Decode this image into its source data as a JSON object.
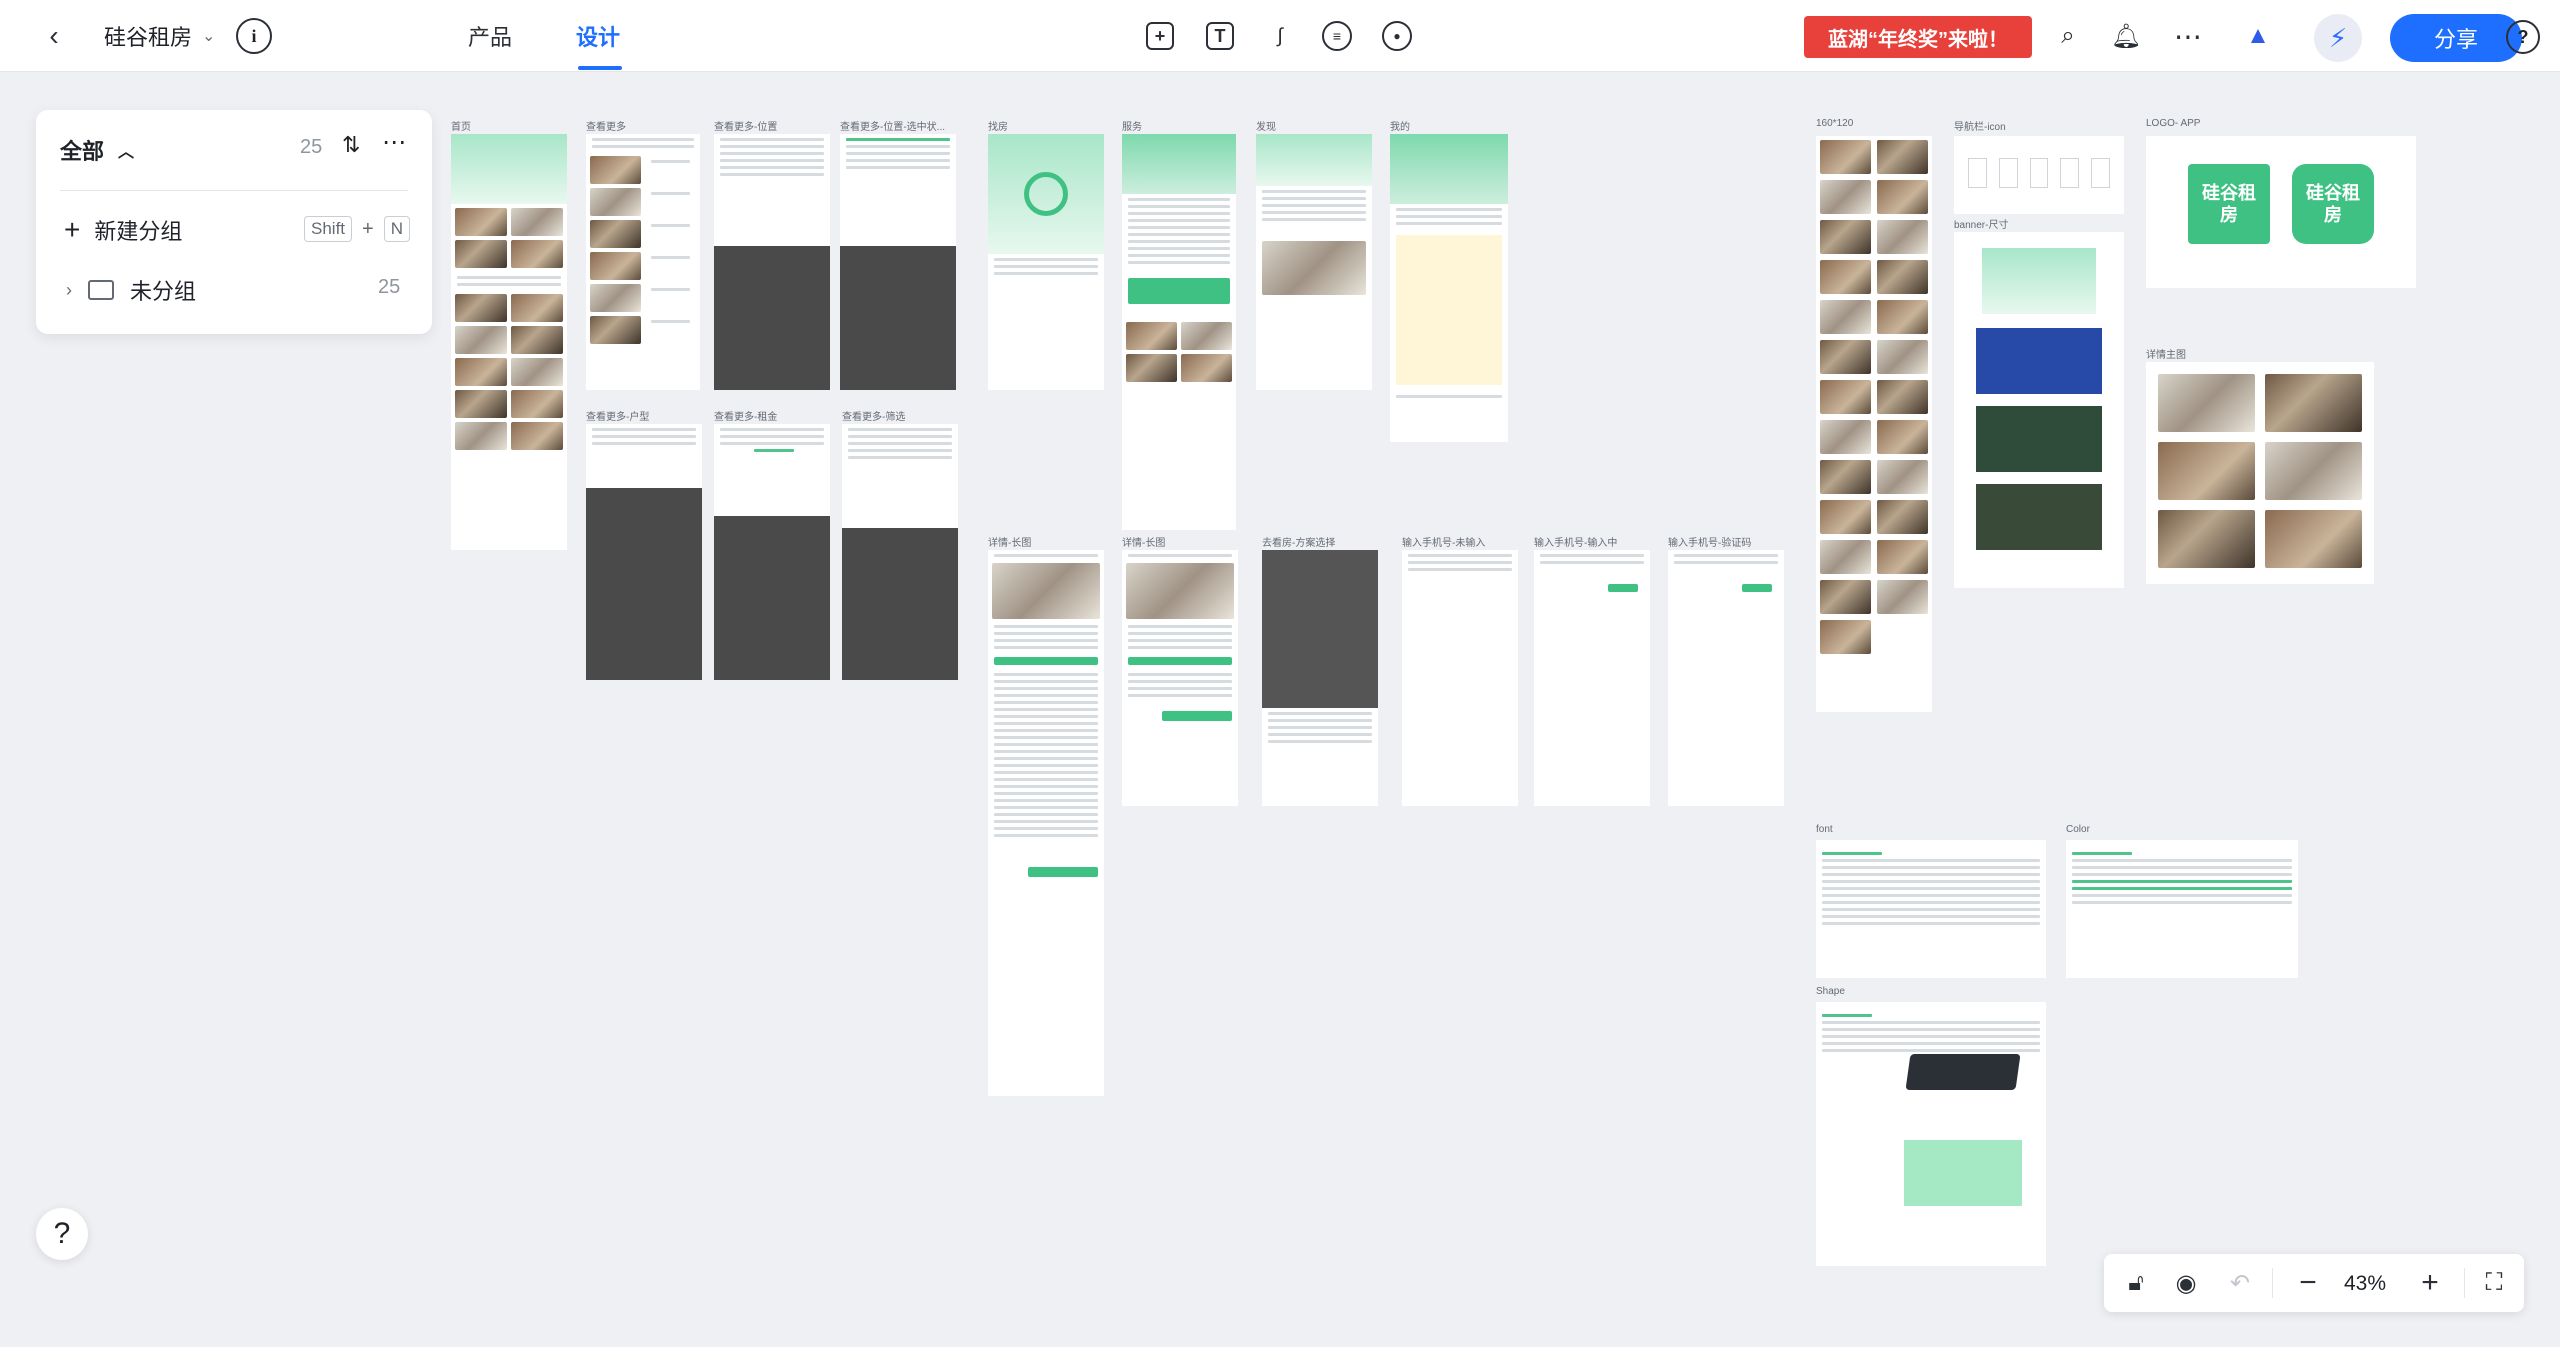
{
  "header": {
    "back_icon": "chevron-left-icon",
    "project_name": "硅谷租房",
    "tabs": [
      {
        "label": "产品",
        "active": false
      },
      {
        "label": "设计",
        "active": true
      }
    ],
    "toolbar_icons": [
      "frame-tool-icon",
      "text-tool-icon",
      "pen-tool-icon",
      "comment-icon",
      "preview-eye-icon"
    ],
    "promo_banner": "蓝湖“年终奖”来啦！",
    "share_label": "分享",
    "accent_color": "#1e6fff",
    "promo_color": "#e8403a"
  },
  "panel": {
    "title": "全部",
    "count": "25",
    "new_group_label": "新建分组",
    "shortcut_shift": "Shift",
    "shortcut_plus": "+",
    "shortcut_key": "N",
    "groups": [
      {
        "name": "未分组",
        "count": "25"
      }
    ]
  },
  "artboards": {
    "home": "首页",
    "more": "查看更多",
    "more_location": "查看更多-位置",
    "more_location_selected": "查看更多-位置-选中状...",
    "more_layout": "查看更多-户型",
    "more_rent": "查看更多-租金",
    "more_filter": "查看更多-筛选",
    "housing": "找房",
    "service": "服务",
    "discover": "发现",
    "mine": "我的",
    "detail_a": "详情-长图",
    "detail_b": "详情-长图",
    "visit_select": "去看房-方案选择",
    "phone_input": "输入手机号-未输入",
    "phone_input_typing": "输入手机号-输入中",
    "phone_input_code": "输入手机号-验证码",
    "size_160": "160*120",
    "nav_icon": "导航栏-icon",
    "banner": "banner-尺寸",
    "logo_app": "LOGO- APP",
    "detail_main": "详情主图",
    "font": "font",
    "color": "Color",
    "shape": "Shape"
  },
  "logo_text": "硅谷租房",
  "zoom": {
    "level": "43%"
  }
}
